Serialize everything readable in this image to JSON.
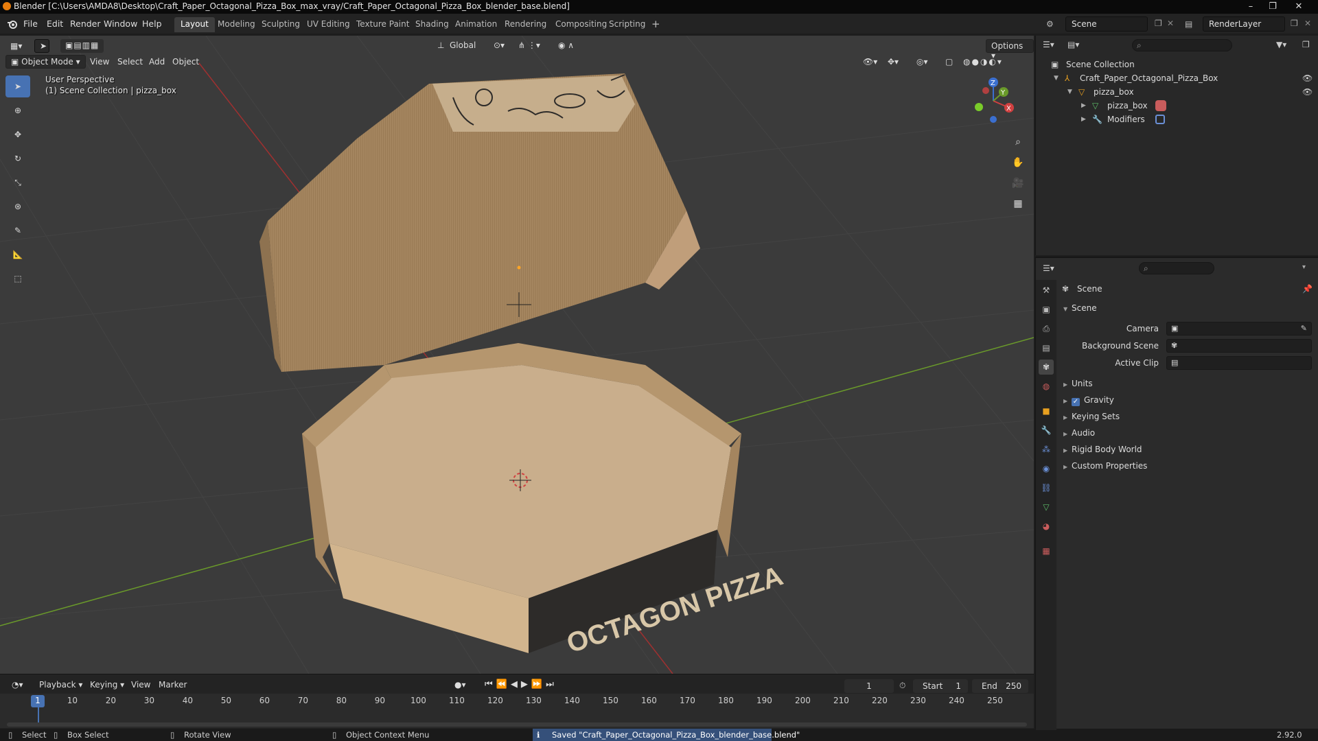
{
  "window": {
    "title": "Blender [C:\\Users\\AMDA8\\Desktop\\Craft_Paper_Octagonal_Pizza_Box_max_vray/Craft_Paper_Octagonal_Pizza_Box_blender_base.blend]",
    "minimize": "–",
    "maximize": "❐",
    "close": "✕"
  },
  "menubar": {
    "items": [
      "File",
      "Edit",
      "Render",
      "Window",
      "Help"
    ],
    "workspaces": [
      "Layout",
      "Modeling",
      "Sculpting",
      "UV Editing",
      "Texture Paint",
      "Shading",
      "Animation",
      "Rendering",
      "Compositing",
      "Scripting"
    ],
    "active_workspace": "Layout",
    "add_workspace": "+",
    "scene": "Scene",
    "view_layer": "RenderLayer"
  },
  "viewport": {
    "header": {
      "transform_orientation": "Global",
      "options": "Options",
      "mode": "Object Mode",
      "menus": [
        "View",
        "Select",
        "Add",
        "Object"
      ]
    },
    "overlay": {
      "perspective": "User Perspective",
      "collection": "(1) Scene Collection | pizza_box"
    },
    "gizmo": {
      "x": "X",
      "y": "Y",
      "z": "Z"
    },
    "box_text": "OCTAGON PIZZA",
    "colors": {
      "background": "#3b3b3b",
      "grid": "#444444",
      "x_axis": "#a03030",
      "y_axis": "#6a9a2a",
      "box_outer": "#a4855f",
      "box_inner": "#c9ae8c",
      "box_wall": "#b5966e",
      "box_print": "#2d2b29"
    }
  },
  "timeline": {
    "menus": [
      "Playback",
      "Keying",
      "View",
      "Marker"
    ],
    "current_frame": "1",
    "start_label": "Start",
    "start": "1",
    "end_label": "End",
    "end": "250",
    "ruler": [
      "1",
      "10",
      "20",
      "30",
      "40",
      "50",
      "60",
      "70",
      "80",
      "90",
      "100",
      "110",
      "120",
      "130",
      "140",
      "150",
      "160",
      "170",
      "180",
      "190",
      "200",
      "210",
      "220",
      "230",
      "240",
      "250"
    ]
  },
  "statusbar": {
    "select": "Select",
    "box_select": "Box Select",
    "rotate_view": "Rotate View",
    "context_menu": "Object Context Menu",
    "message": "Saved \"Craft_Paper_Octagonal_Pizza_Box_blender_base.blend\"",
    "version": "2.92.0"
  },
  "outliner": {
    "root": "Scene Collection",
    "items": [
      {
        "label": "Craft_Paper_Octagonal_Pizza_Box"
      },
      {
        "label": "pizza_box"
      },
      {
        "label": "pizza_box"
      },
      {
        "label": "Modifiers"
      }
    ]
  },
  "properties": {
    "context": "Scene",
    "panel": "Scene",
    "fields": [
      {
        "label": "Camera",
        "value": ""
      },
      {
        "label": "Background Scene",
        "value": ""
      },
      {
        "label": "Active Clip",
        "value": ""
      }
    ],
    "subpanels": [
      "Units",
      "Gravity",
      "Keying Sets",
      "Audio",
      "Rigid Body World",
      "Custom Properties"
    ],
    "gravity_checked": true
  }
}
